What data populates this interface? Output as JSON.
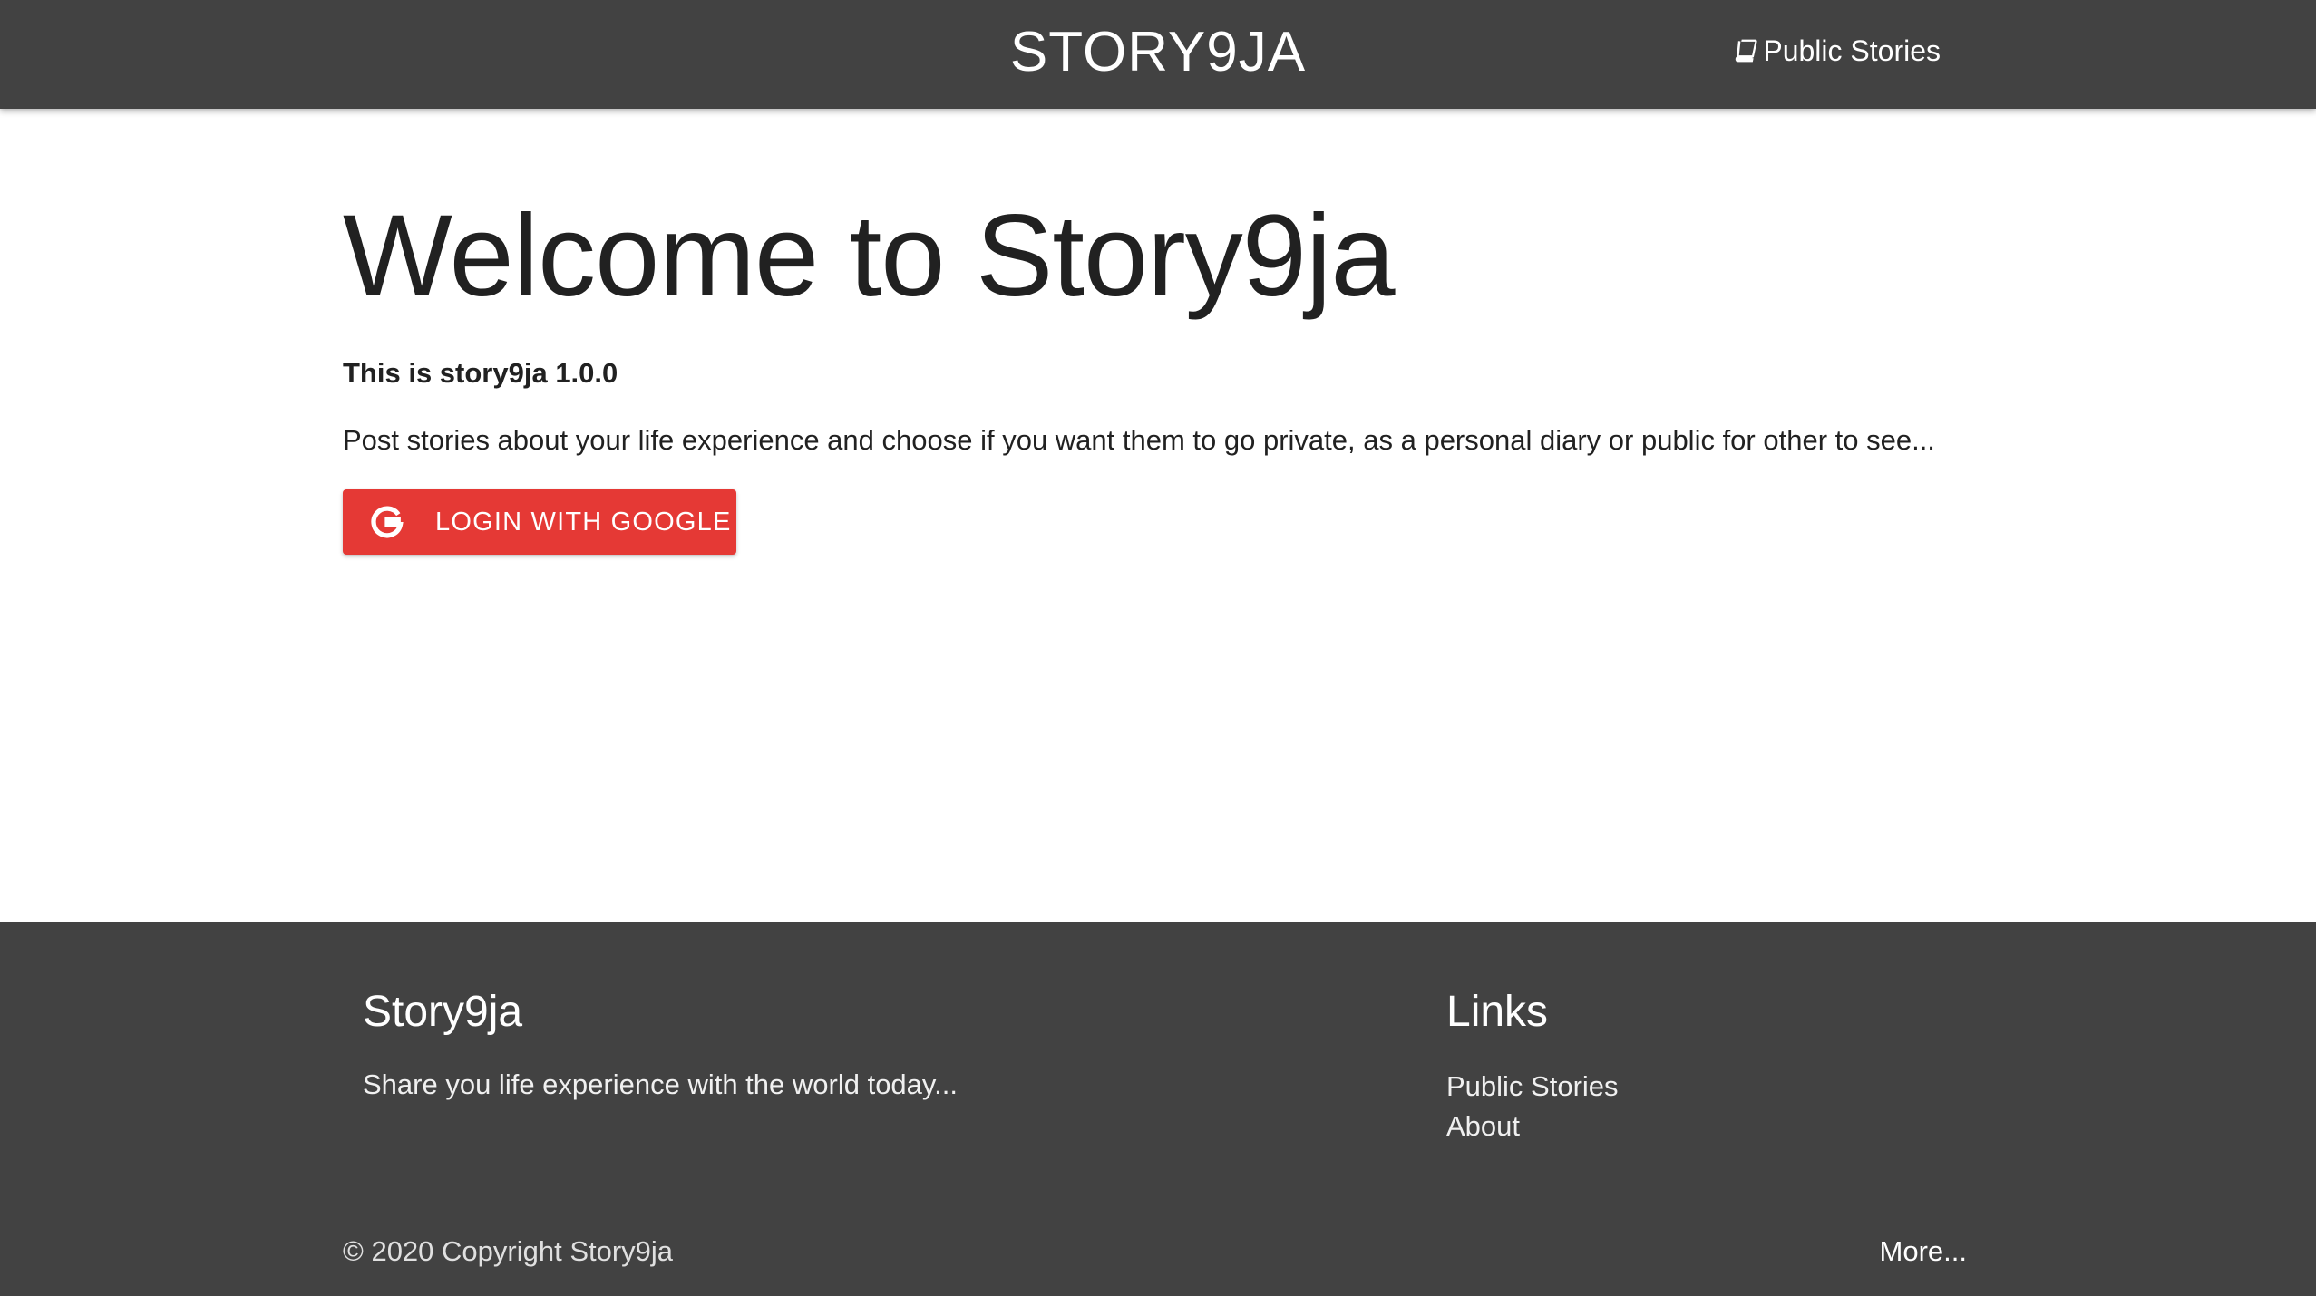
{
  "navbar": {
    "brand": "STORY9JA",
    "public_stories_label": "Public Stories",
    "public_stories_icon": "book-icon"
  },
  "main": {
    "title": "Welcome to Story9ja",
    "version_text": "This is story9ja 1.0.0",
    "description": "Post stories about your life experience and choose if you want them to go private, as a personal diary or public for other to see...",
    "login_button": {
      "label": "LOGIN WITH GOOGLE",
      "icon": "google-icon",
      "color": "#e53935"
    }
  },
  "footer": {
    "brand": "Story9ja",
    "tagline": "Share you life experience with the world today...",
    "links_title": "Links",
    "links": [
      {
        "label": "Public Stories"
      },
      {
        "label": "About"
      }
    ],
    "copyright": "© 2020 Copyright Story9ja",
    "more_label": "More..."
  },
  "colors": {
    "navbar_bg": "#424242",
    "footer_bg": "#424242",
    "accent_red": "#e53935"
  }
}
